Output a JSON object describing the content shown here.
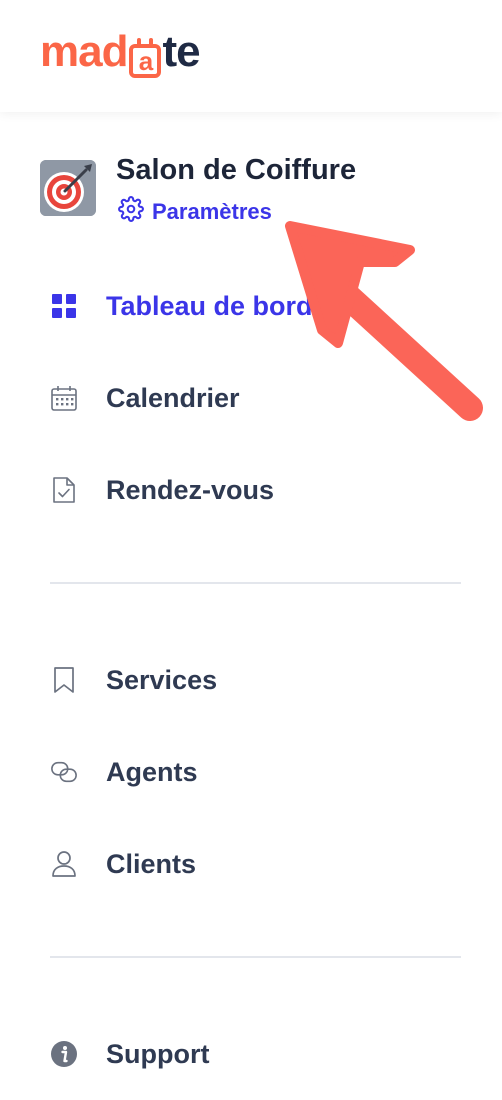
{
  "brand": {
    "logo_text": "madate",
    "part1": "ma",
    "part2": "d",
    "part3": "a",
    "part4": "te"
  },
  "profile": {
    "name": "Salon de Coiffure",
    "settings_label": "Paramètres",
    "avatar_icon": "target-dart-icon"
  },
  "nav": {
    "primary": [
      {
        "label": "Tableau de bord",
        "icon": "dashboard-grid-icon",
        "active": true
      },
      {
        "label": "Calendrier",
        "icon": "calendar-icon",
        "active": false
      },
      {
        "label": "Rendez-vous",
        "icon": "document-check-icon",
        "active": false
      }
    ],
    "secondary": [
      {
        "label": "Services",
        "icon": "bookmark-icon"
      },
      {
        "label": "Agents",
        "icon": "chain-link-icon"
      },
      {
        "label": "Clients",
        "icon": "user-icon"
      }
    ],
    "footer": [
      {
        "label": "Support",
        "icon": "info-icon"
      }
    ]
  },
  "colors": {
    "accent": "#3b35e8",
    "brand_orange": "#fb6647",
    "annotation_arrow": "#fb6558",
    "text": "#2f3a52",
    "divider": "#e3e6ec"
  }
}
